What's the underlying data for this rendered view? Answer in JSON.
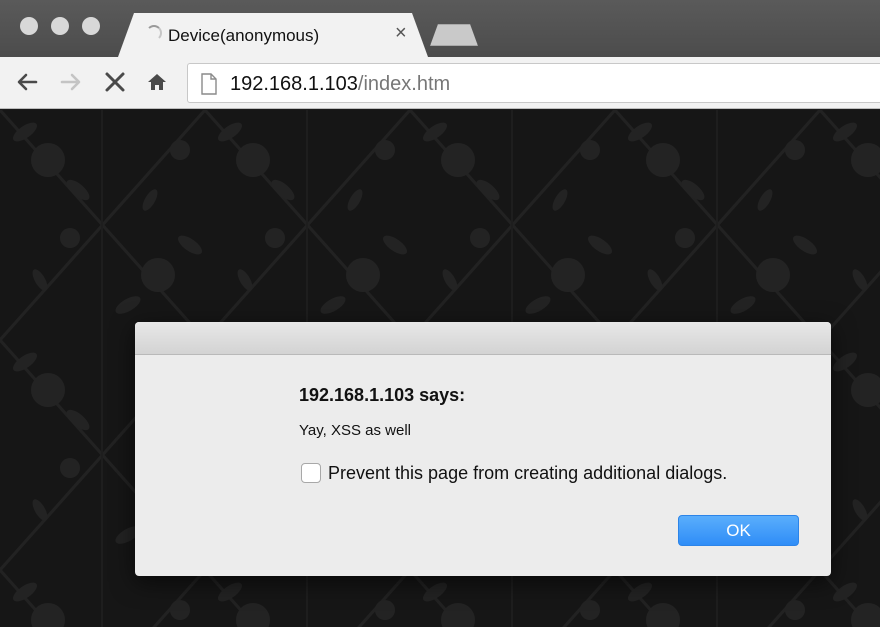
{
  "window": {
    "tab": {
      "title": "Device(anonymous)",
      "close_glyph": "×"
    }
  },
  "toolbar": {
    "url_host": "192.168.1.103",
    "url_path": "/index.htm"
  },
  "dialog": {
    "heading": "192.168.1.103 says:",
    "message": "Yay, XSS as well",
    "checkbox_label": "Prevent this page from creating additional dialogs.",
    "checkbox_checked": false,
    "ok_label": "OK"
  },
  "colors": {
    "page_background": "#161616",
    "ok_button": "#3d97f9",
    "tabstrip": "#505050"
  }
}
